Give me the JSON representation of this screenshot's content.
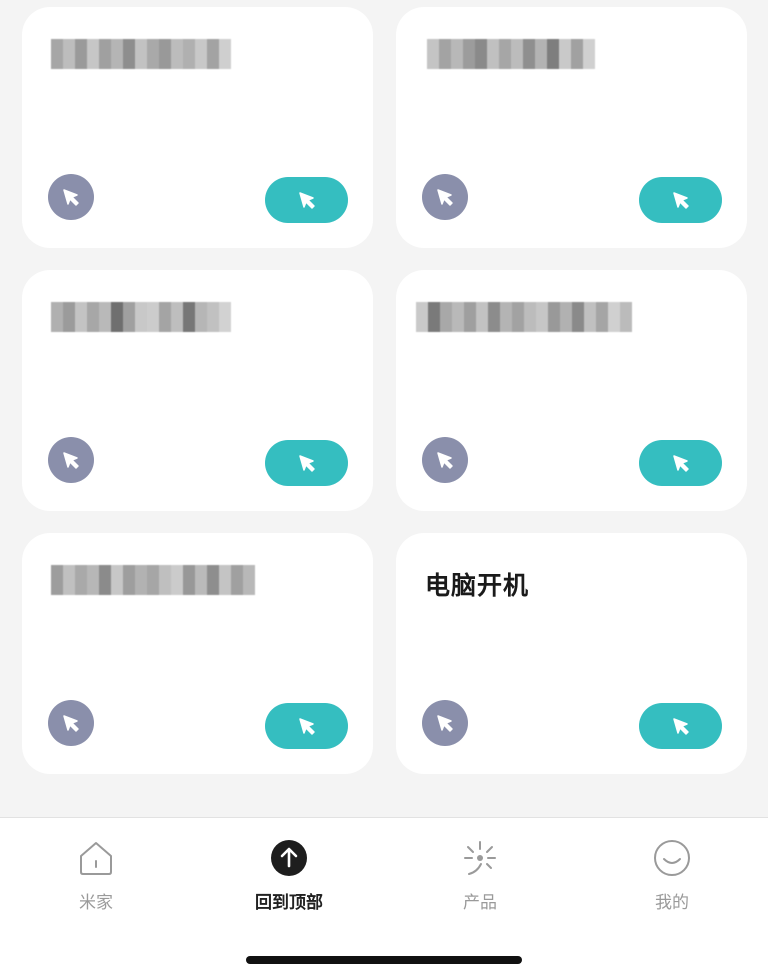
{
  "scenes": [
    {
      "title": "",
      "redacted": true
    },
    {
      "title": "",
      "redacted": true
    },
    {
      "title": "",
      "redacted": true
    },
    {
      "title": "",
      "redacted": true
    },
    {
      "title": "",
      "redacted": true
    },
    {
      "title": "电脑开机",
      "redacted": false
    }
  ],
  "tabbar": {
    "home": "米家",
    "top": "回到顶部",
    "products": "产品",
    "mine": "我的"
  },
  "colors": {
    "accent": "#35bec0",
    "secondary_button": "#8a8fab",
    "background": "#f4f4f4",
    "card": "#ffffff"
  },
  "icons": {
    "scene_round": "cursor-arrow-icon",
    "scene_pill": "cursor-arrow-icon",
    "home": "house-icon",
    "top": "arrow-up-circle-icon",
    "products": "sparkle-icon",
    "mine": "smiley-icon"
  }
}
